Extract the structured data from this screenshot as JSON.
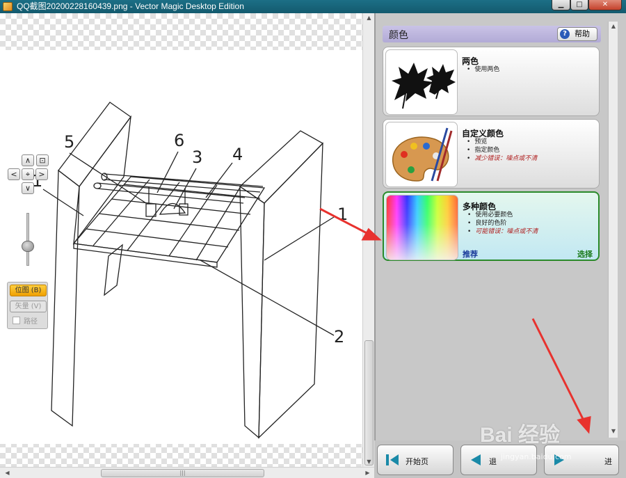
{
  "window": {
    "title": "QQ截图20200228160439.png - Vector Magic Desktop Edition",
    "controls": {
      "minimize": "▁",
      "maximize": "□",
      "close": "✕"
    }
  },
  "canvas": {
    "drawing_labels": [
      "5",
      "6",
      "3",
      "4",
      "1",
      "1",
      "2"
    ]
  },
  "nav": {
    "up": "∧",
    "down": "∨",
    "left": "<",
    "right": ">",
    "center": "⌖",
    "fit": "⊡"
  },
  "modes": {
    "bitmap": "位图 (B)",
    "vector": "矢量 (V)",
    "path": "路径",
    "active": "bitmap"
  },
  "panel": {
    "title": "颜色",
    "help": "帮助",
    "options": [
      {
        "id": "two-color",
        "title": "两色",
        "bullets": [
          {
            "text": "使用两色",
            "warn": false
          }
        ]
      },
      {
        "id": "custom-color",
        "title": "自定义颜色",
        "bullets": [
          {
            "text": "预览",
            "warn": false
          },
          {
            "text": "指定颜色",
            "warn": false
          },
          {
            "text": "减少错误：噪点或不清",
            "warn": true
          }
        ]
      },
      {
        "id": "multi-color",
        "title": "多种颜色",
        "selected": true,
        "bullets": [
          {
            "text": "使用必要颜色",
            "warn": false
          },
          {
            "text": "良好的色阶",
            "warn": false
          },
          {
            "text": "可能错误：噪点或不清",
            "warn": true
          }
        ],
        "recommended": "推荐",
        "select": "选择"
      }
    ],
    "icons": {
      "two_color": "maple-leaves-icon",
      "custom_color": "paint-palette-icon",
      "multi_color": "color-gradient-icon"
    }
  },
  "bottom_nav": {
    "start": "开始页",
    "back": "退",
    "next": "进"
  },
  "watermark": {
    "text": "Bai 经验",
    "sub": "jingyan.baidu.com"
  },
  "colors": {
    "accent_selected": "#2a8a2a",
    "mode_active": "#f0a000",
    "annotation": "#e8322e"
  }
}
